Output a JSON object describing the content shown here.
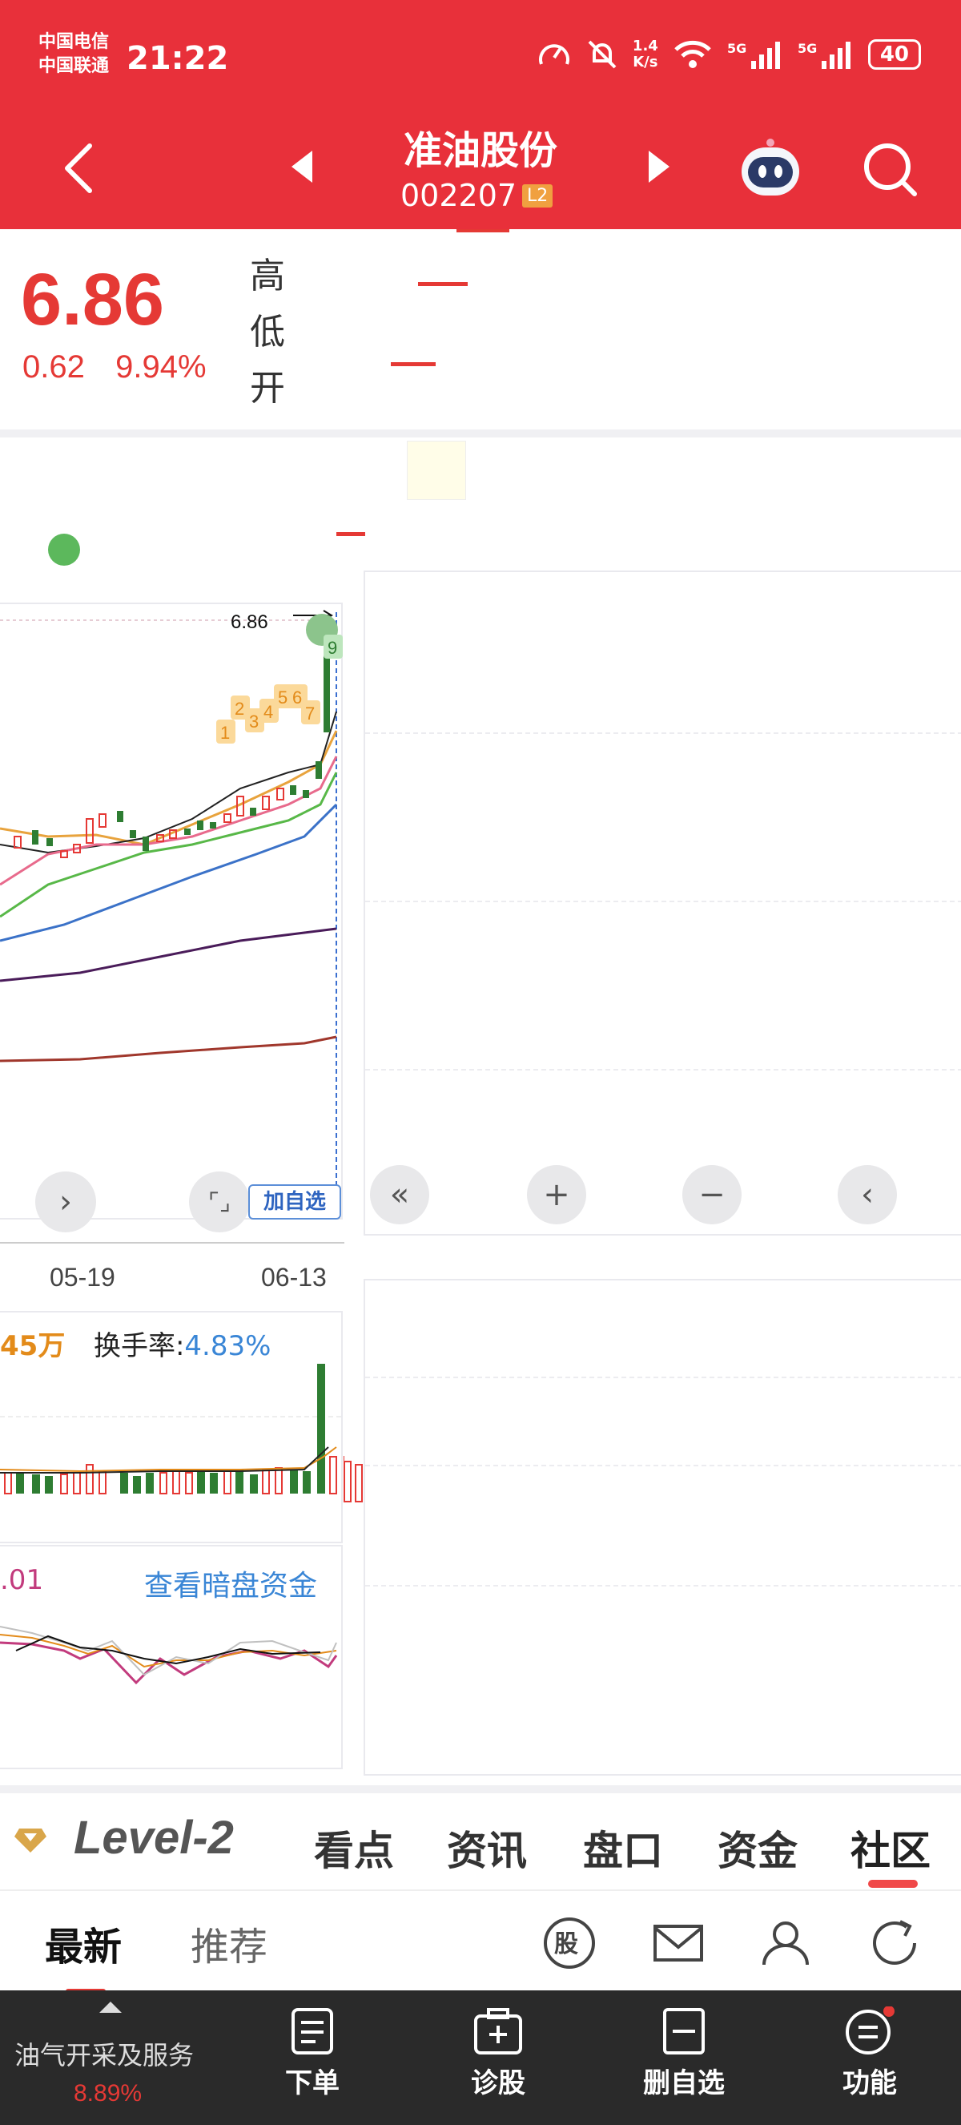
{
  "status": {
    "carrier_1": "中国电信",
    "carrier_2": "中国联通",
    "time": "21:22",
    "net_speed_value": "1.4",
    "net_speed_unit": "K/s",
    "battery": "40"
  },
  "header": {
    "name": "准油股份",
    "code": "002207",
    "badge": "L2"
  },
  "quote": {
    "price": "6.86",
    "change_abs": "0.62",
    "change_pct": "9.94%",
    "label_high": "高",
    "label_low": "低",
    "label_open": "开"
  },
  "kline": {
    "last_price_tag": "6.86",
    "signal_markers": [
      "1",
      "2",
      "3",
      "4",
      "5",
      "6",
      "7",
      "9"
    ],
    "x_labels": [
      "05-19",
      "06-13"
    ],
    "add_fav": "加自选"
  },
  "volume": {
    "value_fragment": "45万",
    "turnover_label": "换手率:",
    "turnover_value": "4.83%"
  },
  "indicator": {
    "value_fragment": ".01",
    "link": "查看暗盘资金"
  },
  "colors": {
    "brand_red": "#e8303a",
    "up_red": "#e53935",
    "down_green": "#2e7d32",
    "link_blue": "#3a86d6"
  },
  "tabs": {
    "level2": "Level-2",
    "items": [
      "看点",
      "资讯",
      "盘口",
      "资金",
      "社区"
    ],
    "active": "社区"
  },
  "subtabs": {
    "latest": "最新",
    "recommend": "推荐"
  },
  "bottom": {
    "sector": "油气开采及服务",
    "sector_pct": "8.89%",
    "order": "下单",
    "diagnose": "诊股",
    "remove_fav": "删自选",
    "function": "功能"
  },
  "icons": [
    "back-icon",
    "prev-stock-icon",
    "next-stock-icon",
    "robot-icon",
    "search-icon",
    "fast-back-icon",
    "zoom-in-icon",
    "zoom-out-icon",
    "step-back-icon",
    "expand-icon",
    "next-icon",
    "diamond-icon",
    "stock-circle-icon",
    "mail-icon",
    "user-icon",
    "refresh-icon",
    "order-icon",
    "diagnose-icon",
    "remove-fav-icon",
    "function-icon"
  ]
}
